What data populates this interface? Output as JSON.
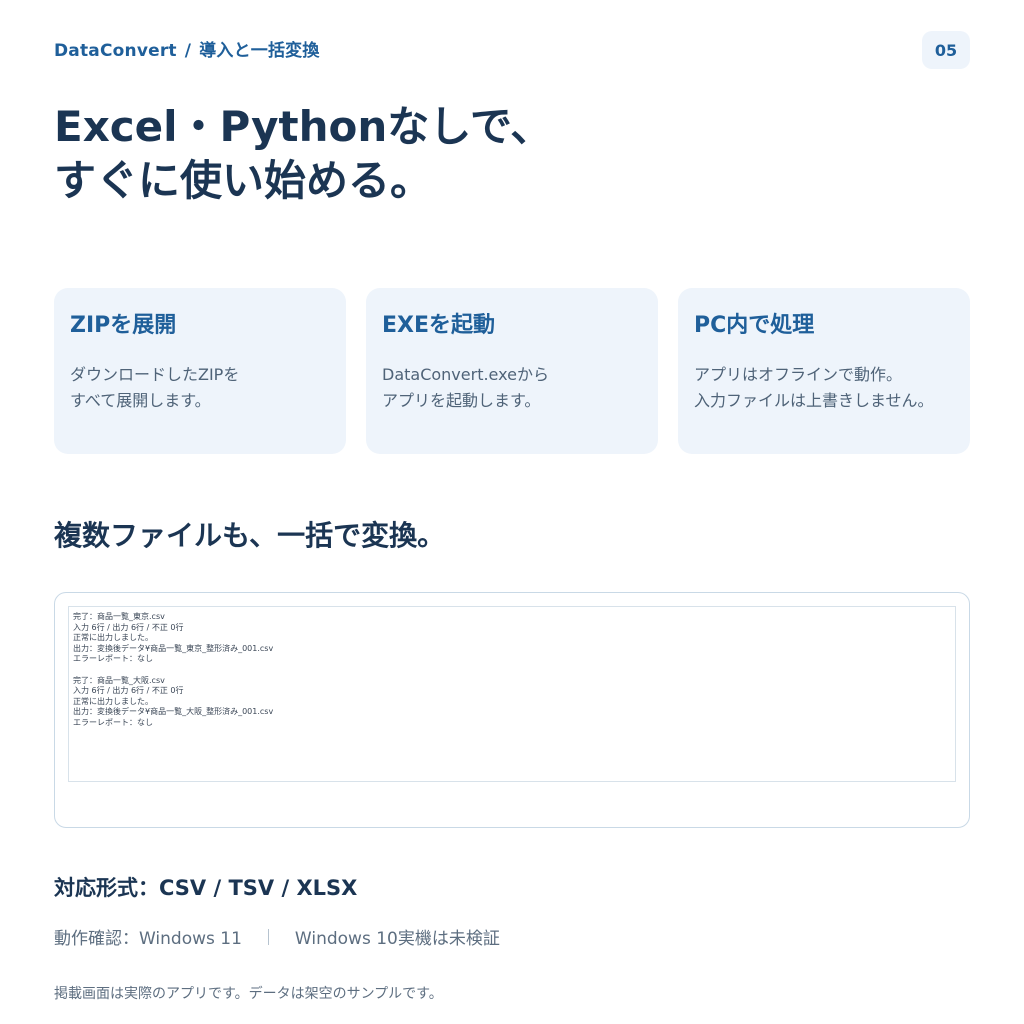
{
  "header": {
    "app_name": "DataConvert",
    "separator": "/",
    "section": "導入と一括変換",
    "page_number": "05"
  },
  "hero": {
    "line1": "Excel・Pythonなしで、",
    "line2": "すぐに使い始める。"
  },
  "steps": [
    {
      "title": "ZIPを展開",
      "desc_line1": "ダウンロードしたZIPを",
      "desc_line2": "すべて展開します。"
    },
    {
      "title": "EXEを起動",
      "desc_line1": "DataConvert.exeから",
      "desc_line2": "アプリを起動します。"
    },
    {
      "title": "PC内で処理",
      "desc_line1": "アプリはオフラインで動作。",
      "desc_line2": "入力ファイルは上書きしません。"
    }
  ],
  "batch_section": {
    "title": "複数ファイルも、一括で変換。"
  },
  "log": {
    "lines": [
      "完了：商品一覧_東京.csv",
      "入力 6行 / 出力 6行 / 不正 0行",
      "正常に出力しました。",
      "出力：変換後データ¥商品一覧_東京_整形済み_001.csv",
      "エラーレポート：なし",
      "",
      "完了：商品一覧_大阪.csv",
      "入力 6行 / 出力 6行 / 不正 0行",
      "正常に出力しました。",
      "出力：変換後データ¥商品一覧_大阪_整形済み_001.csv",
      "エラーレポート：なし"
    ]
  },
  "formats": {
    "text": "対応形式：CSV / TSV / XLSX"
  },
  "compatibility": {
    "verified": "動作確認：Windows 11",
    "unverified": "Windows 10実機は未検証"
  },
  "footnote": "掲載画面は実際のアプリです。データは架空のサンプルです。"
}
